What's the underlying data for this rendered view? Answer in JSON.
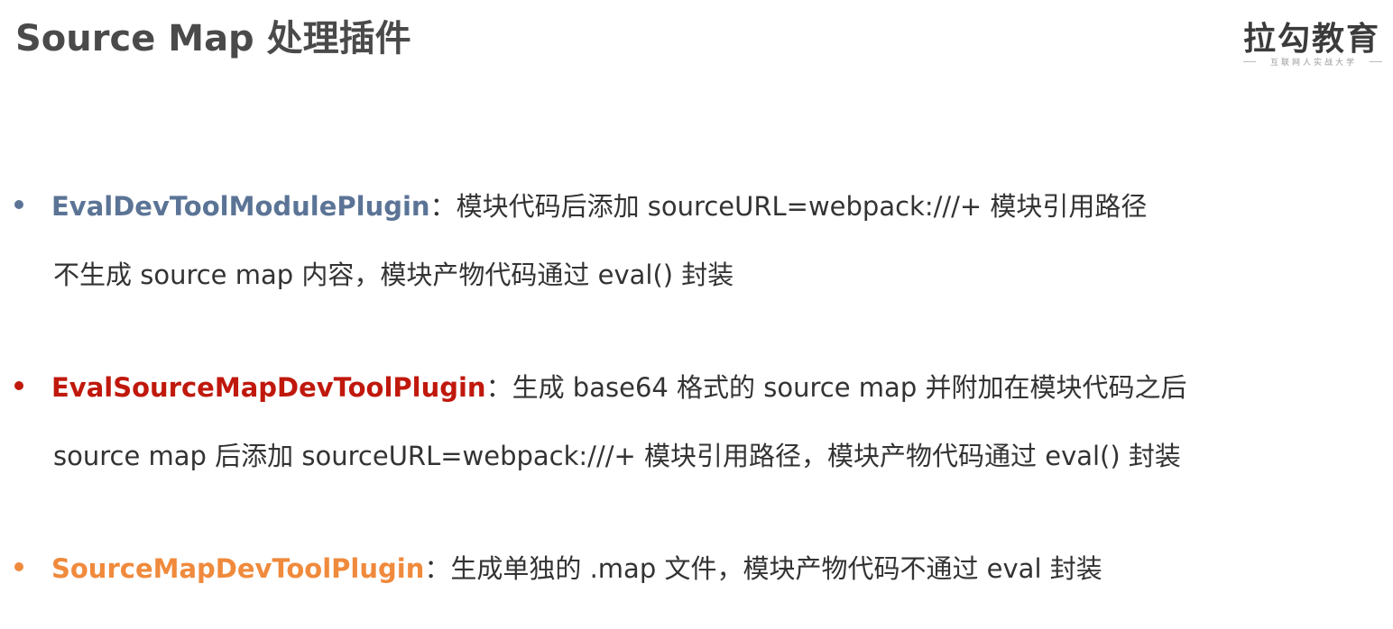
{
  "title": "Source Map 处理插件",
  "logo": {
    "main": "拉勾教育",
    "sub": "互联网人实战大学"
  },
  "items": [
    {
      "name": "EvalDevToolModulePlugin",
      "color": "#5b7496",
      "separator": "：",
      "desc": "模块代码后添加 sourceURL=webpack:///+ 模块引用路径",
      "detail": "不生成 source map 内容，模块产物代码通过 eval() 封装"
    },
    {
      "name": "EvalSourceMapDevToolPlugin",
      "color": "#c0180c",
      "separator": "：",
      "desc": "生成 base64 格式的 source map 并附加在模块代码之后",
      "detail": "source map 后添加 sourceURL=webpack:///+ 模块引用路径，模块产物代码通过 eval() 封装"
    },
    {
      "name": "SourceMapDevToolPlugin",
      "color": "#f08a3c",
      "separator": "：",
      "desc": "生成单独的 .map 文件，模块产物代码不通过 eval 封装",
      "detail": ""
    }
  ]
}
